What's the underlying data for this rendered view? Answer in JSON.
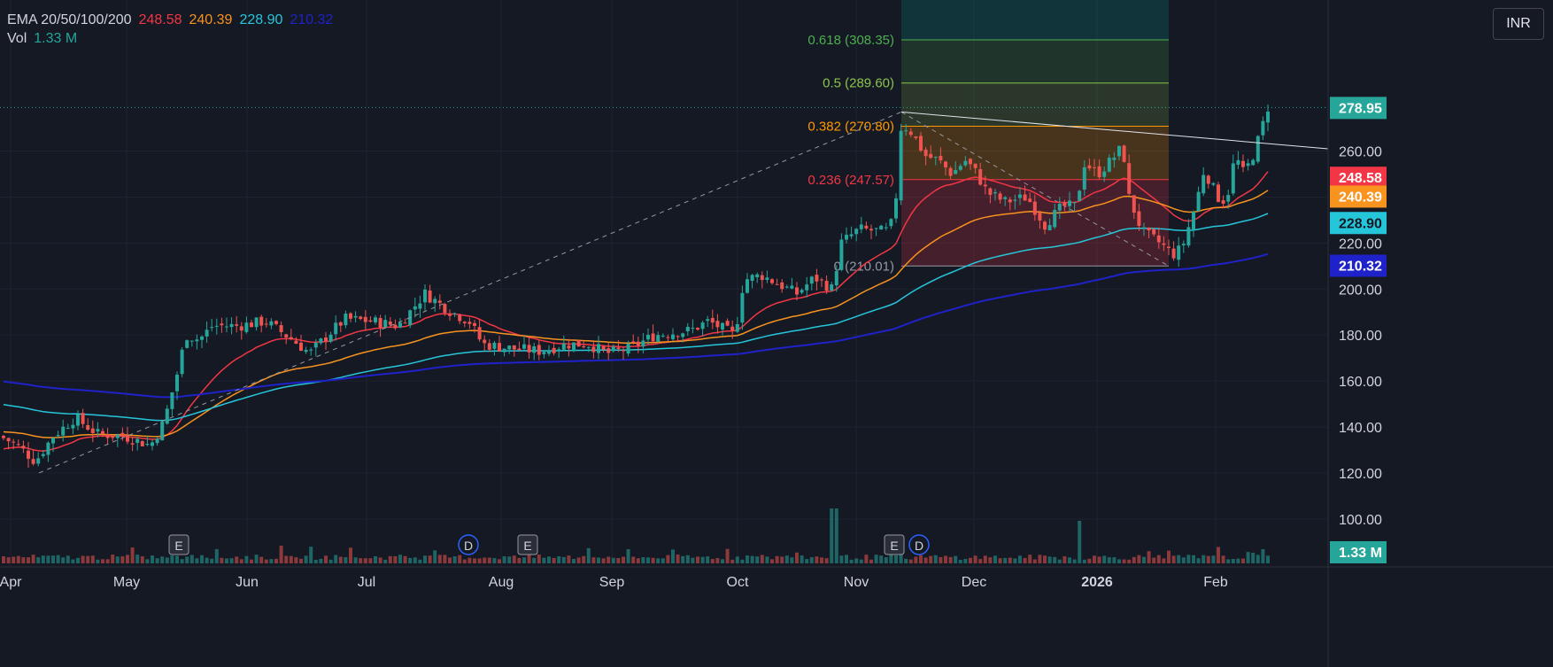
{
  "legend": {
    "ema_label": "EMA 20/50/100/200",
    "ema20": "248.58",
    "ema50": "240.39",
    "ema100": "228.90",
    "ema200": "210.32",
    "vol_label": "Vol",
    "vol_value": "1.33 M"
  },
  "currency_button": "INR",
  "colors": {
    "background": "#151924",
    "up": "#26a69a",
    "down": "#ef5350",
    "ema20": "#f23645",
    "ema50": "#f7931e",
    "ema100": "#26c6da",
    "ema200": "#1e22c8",
    "text": "#d1d4dc",
    "grid": "#1f2330"
  },
  "chart_data": {
    "type": "candlestick",
    "y_ticks": [
      "260.00",
      "240.00",
      "220.00",
      "200.00",
      "180.00",
      "160.00",
      "140.00",
      "120.00",
      "100.00"
    ],
    "x_labels": [
      "Apr",
      "May",
      "Jun",
      "Jul",
      "Aug",
      "Sep",
      "Oct",
      "Nov",
      "Dec",
      "2026",
      "Feb"
    ],
    "last_price": "278.95",
    "volume_label": "1.33 M",
    "ema_labels": [
      {
        "name": "EMA 20",
        "value": "248.58",
        "color": "#f23645"
      },
      {
        "name": "EMA 50",
        "value": "240.39",
        "color": "#f7931e"
      },
      {
        "name": "EMA 100",
        "value": "228.90",
        "color": "#26c6da"
      },
      {
        "name": "EMA 200",
        "value": "210.32",
        "color": "#1e22c8"
      }
    ],
    "fib_levels": [
      {
        "ratio": "0.618",
        "price": 308.35,
        "label": "0.618 (308.35)",
        "color": "#4caf50"
      },
      {
        "ratio": "0.5",
        "price": 289.6,
        "label": "0.5 (289.60)",
        "color": "#8bc34a"
      },
      {
        "ratio": "0.382",
        "price": 270.8,
        "label": "0.382 (270.80)",
        "color": "#ff9800"
      },
      {
        "ratio": "0.236",
        "price": 247.57,
        "label": "0.236 (247.57)",
        "color": "#f23645"
      },
      {
        "ratio": "0",
        "price": 210.01,
        "label": "0 (210.01)",
        "color": "#9598a1"
      }
    ],
    "markers": [
      {
        "type": "E",
        "month": "May"
      },
      {
        "type": "D",
        "month": "Jul"
      },
      {
        "type": "E",
        "month": "Aug"
      },
      {
        "type": "E",
        "month": "Nov"
      },
      {
        "type": "D",
        "month": "Nov"
      }
    ],
    "ylim": [
      93,
      318
    ]
  }
}
